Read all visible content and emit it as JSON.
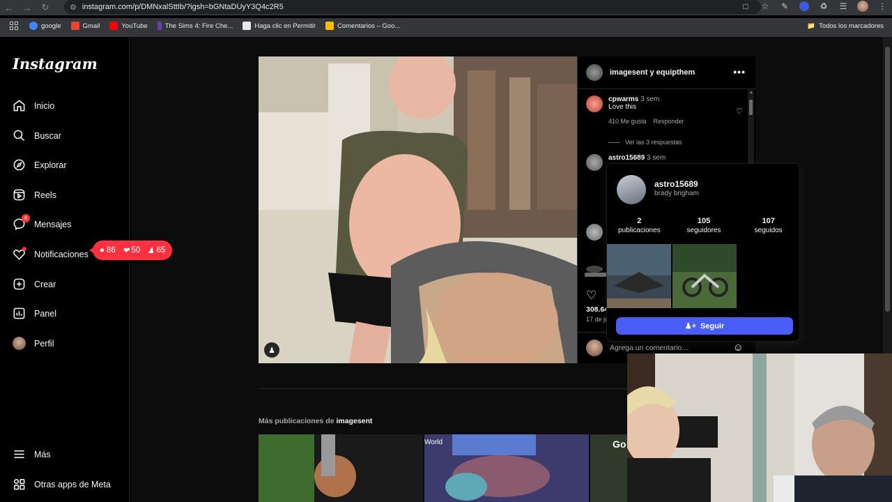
{
  "browser": {
    "url": "instagram.com/p/DMNxalSttIb/?igsh=bGNtaDUyY3Q4c2R5",
    "bookmarks": [
      {
        "label": "google",
        "color": "#4285f4"
      },
      {
        "label": "Gmail",
        "color": "#ea4335"
      },
      {
        "label": "YouTube",
        "color": "#ff0000"
      },
      {
        "label": "The Sims 4: Fire Che...",
        "color": "#6a3fb5"
      },
      {
        "label": "Haga clic en Permitir",
        "color": "#e8eaed"
      },
      {
        "label": "Comentarios – Goo...",
        "color": "#fbbc04"
      }
    ],
    "all_bookmarks": "Todos los marcadores"
  },
  "sidebar": {
    "logo": "Instagram",
    "items": [
      {
        "label": "Inicio",
        "icon": "home-icon"
      },
      {
        "label": "Buscar",
        "icon": "search-icon"
      },
      {
        "label": "Explorar",
        "icon": "compass-icon"
      },
      {
        "label": "Reels",
        "icon": "reels-icon"
      },
      {
        "label": "Mensajes",
        "icon": "messenger-icon",
        "badge": "8"
      },
      {
        "label": "Notificaciones",
        "icon": "heart-icon"
      },
      {
        "label": "Crear",
        "icon": "plus-square-icon"
      },
      {
        "label": "Panel",
        "icon": "chart-icon"
      },
      {
        "label": "Perfil",
        "icon": "avatar"
      }
    ],
    "more": "Más",
    "meta_apps": "Otras apps de Meta"
  },
  "activity": {
    "comments": "86",
    "likes": "50",
    "follows": "65",
    "color": "#ff3040"
  },
  "post": {
    "author": "imagesent y equipthem",
    "comments": [
      {
        "user": "cpwarms",
        "time": "3 sem",
        "text": "Love this",
        "likes": "410 Me gusta",
        "reply": "Responder",
        "view_replies": "Ver las 3 respuestas"
      },
      {
        "user": "astro15689",
        "time": "3 sem"
      }
    ],
    "likes_count": "308.64",
    "date": "17 de ju",
    "comment_placeholder": "Agrega un comentario..."
  },
  "hover_card": {
    "username": "astro15689",
    "full_name": "brady brigham",
    "stats": [
      {
        "value": "2",
        "label": "publicaciones"
      },
      {
        "value": "105",
        "label": "seguidores"
      },
      {
        "value": "107",
        "label": "seguidos"
      }
    ],
    "follow_label": "Seguir",
    "follow_color": "#4a5df9"
  },
  "more_posts": {
    "prefix": "Más publicaciones de",
    "user": "imagesent",
    "thumb_labels": [
      "World",
      "Go"
    ]
  }
}
